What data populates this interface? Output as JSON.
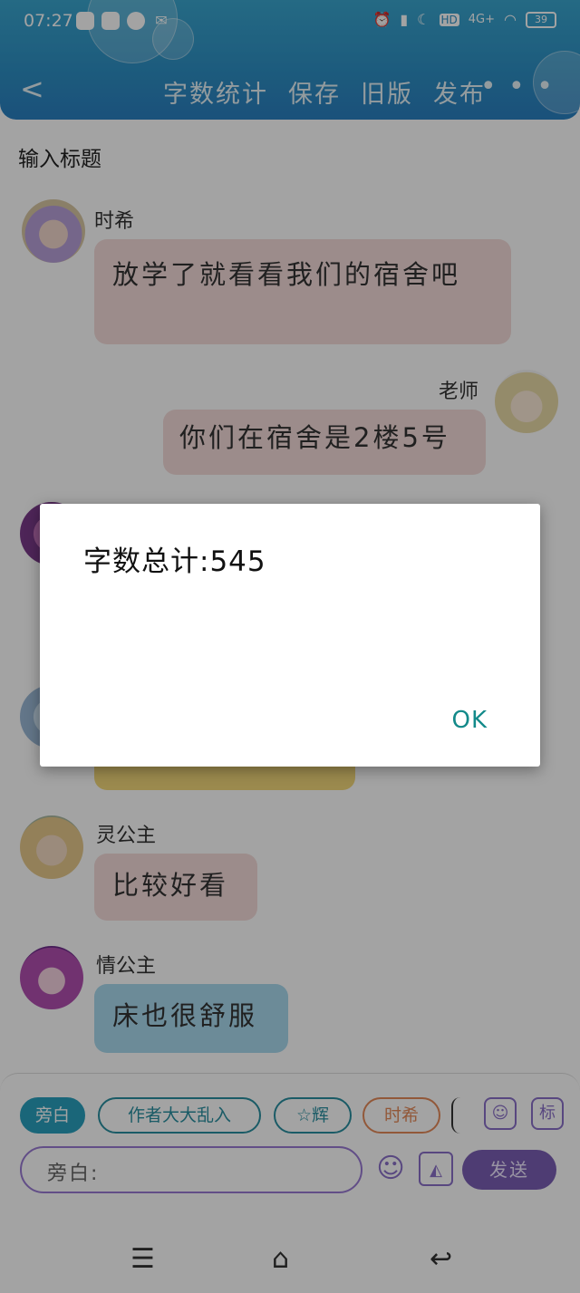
{
  "status": {
    "time": "07:27",
    "net": "4G+",
    "hd": "HD",
    "battery": "39"
  },
  "header": {
    "back": "<",
    "items": [
      "字数统计",
      "保存",
      "旧版",
      "发布"
    ],
    "more": "• • •"
  },
  "title_placeholder": "输入标题",
  "messages": [
    {
      "name": "时希",
      "text": "放学了就看看我们的宿舍吧",
      "side": "left",
      "color": "#f4dcd9"
    },
    {
      "name": "老师",
      "text": "你们在宿舍是2楼5号",
      "side": "right",
      "color": "#f4dcd9"
    }
  ],
  "messages_after": [
    {
      "name": "灵公主",
      "text": "比较好看",
      "color": "#f4dcd9"
    },
    {
      "name": "情公主",
      "text": "床也很舒服",
      "color": "#a9d9ee"
    }
  ],
  "dialog": {
    "message": "字数总计:545",
    "ok": "OK"
  },
  "chips": [
    "旁白",
    "作者大大乱入",
    "☆辉",
    "时希"
  ],
  "chip_colors": {
    "narration": "#2aa0bd",
    "author": "#2a8fa0",
    "hui": "#2a8fa0",
    "shixi": "#e58a5a"
  },
  "icons": {
    "person": "person-icon",
    "mark": "标"
  },
  "input": {
    "placeholder": "旁白:"
  },
  "send_label": "发送"
}
